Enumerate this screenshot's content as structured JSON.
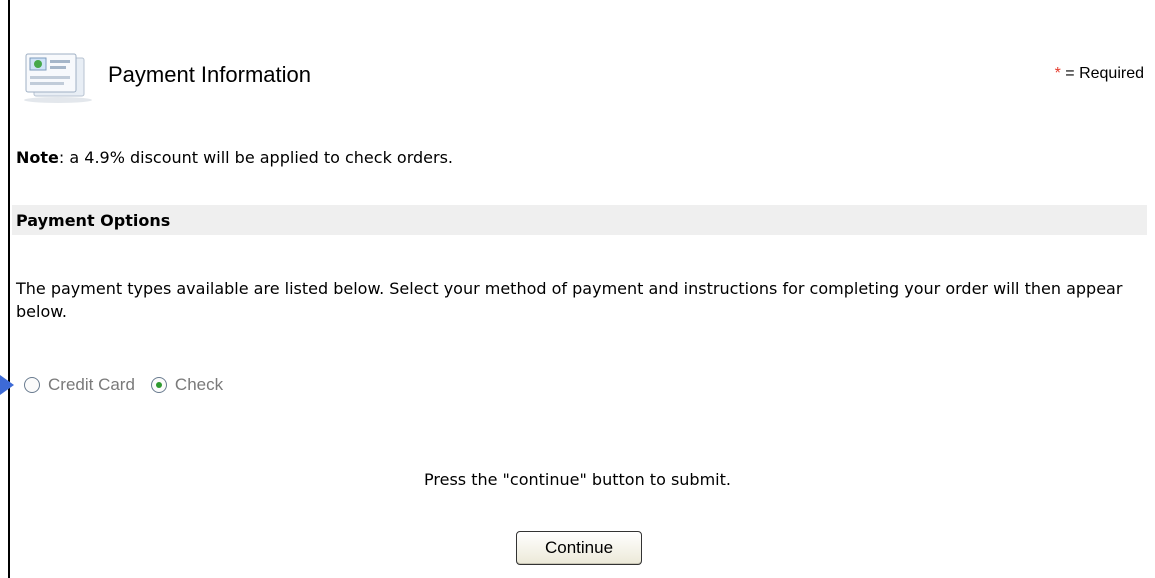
{
  "header": {
    "title": "Payment Information",
    "required_star": "*",
    "required_text": "= Required"
  },
  "note": {
    "label": "Note",
    "text": ": a 4.9% discount will be applied to check orders."
  },
  "section": {
    "title": "Payment Options"
  },
  "description": "The payment types available are listed below. Select your method of payment and instructions for completing your order will then appear below.",
  "payment_options": [
    {
      "label": "Credit Card",
      "selected": false
    },
    {
      "label": "Check",
      "selected": true
    }
  ],
  "instructions": "Press the \"continue\" button to submit.",
  "continue_button": "Continue",
  "colors": {
    "required_star": "#e53b2c",
    "section_bar": "#efefef",
    "pointer_arrow": "#3d6ad6",
    "radio_selected": "#2f9a2f"
  },
  "icons": {
    "header": "payment-form-icon",
    "pointer": "pointer-arrow-icon"
  }
}
